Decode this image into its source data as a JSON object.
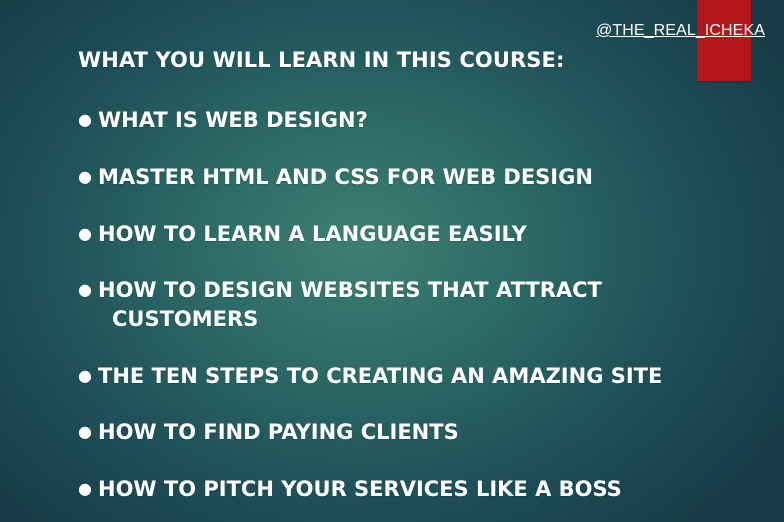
{
  "handle": "@THE_REAL_ICHEKA",
  "title": "WHAT YOU WILL LEARN IN THIS COURSE:",
  "bullet_symbol": "●",
  "items": [
    {
      "text": "WHAT IS WEB DESIGN?"
    },
    {
      "text": "MASTER HTML AND CSS FOR WEB DESIGN"
    },
    {
      "text": "HOW TO LEARN A LANGUAGE EASILY"
    },
    {
      "text": "HOW TO DESIGN WEBSITES THAT ATTRACT",
      "continuation": "CUSTOMERS"
    },
    {
      "text": "THE TEN STEPS TO CREATING AN AMAZING SITE"
    },
    {
      "text": "HOW TO FIND PAYING CLIENTS"
    },
    {
      "text": "HOW TO PITCH YOUR SERVICES LIKE A BOSS"
    }
  ],
  "colors": {
    "background_center": "#3f7f72",
    "background_edge": "#173c47",
    "accent_red": "#b4171b",
    "text": "#ffffff"
  }
}
